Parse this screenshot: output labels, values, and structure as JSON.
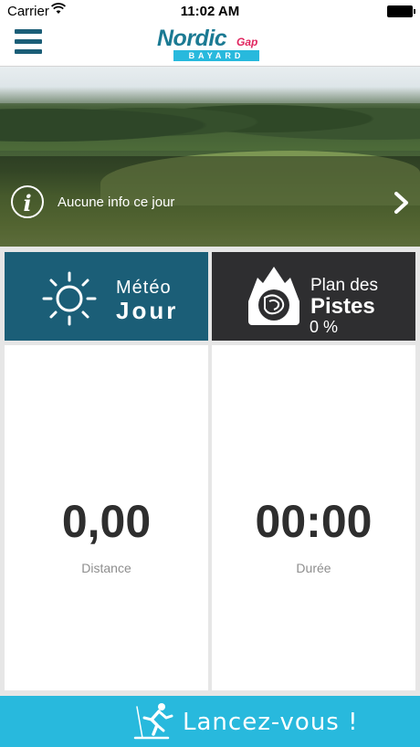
{
  "status_bar": {
    "carrier": "Carrier",
    "time": "11:02 AM"
  },
  "header": {
    "logo_main": "Nordic",
    "logo_gap": "Gap",
    "logo_sub": "BAYARD",
    "menu_icon": "hamburger-menu-icon"
  },
  "hero": {
    "info_text": "Aucune info ce jour",
    "info_icon": "info-icon",
    "next_icon": "chevron-right-icon"
  },
  "tiles": {
    "meteo": {
      "line1": "Météo",
      "line2": "Jour",
      "icon": "sun-icon",
      "color": "#1b5e77"
    },
    "pistes": {
      "line1": "Plan des",
      "line2": "Pistes",
      "progress_text": "0 %",
      "progress": 0,
      "icon": "mountain-map-icon",
      "color": "#2e2e30"
    }
  },
  "stats": {
    "distance": {
      "value": "0,00",
      "label": "Distance"
    },
    "duree": {
      "value": "00:00",
      "label": "Durée"
    }
  },
  "cta": {
    "label": "Lancez-vous !",
    "icon": "skier-icon",
    "color": "#28b9dd"
  }
}
